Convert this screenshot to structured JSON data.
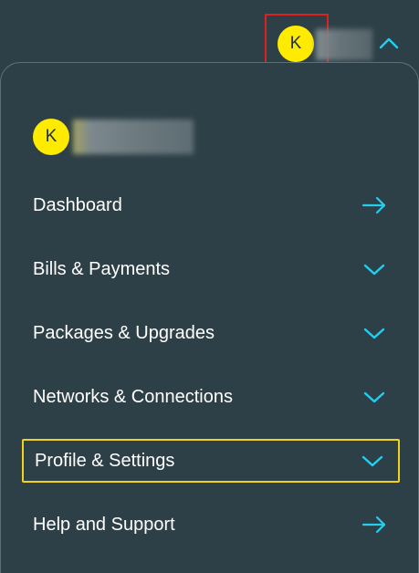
{
  "header": {
    "avatar_initial": "K"
  },
  "profile": {
    "avatar_initial": "K"
  },
  "menu": [
    {
      "label": "Dashboard",
      "icon": "arrow-right-icon"
    },
    {
      "label": "Bills & Payments",
      "icon": "chevron-down-icon"
    },
    {
      "label": "Packages & Upgrades",
      "icon": "chevron-down-icon"
    },
    {
      "label": "Networks & Connections",
      "icon": "chevron-down-icon"
    },
    {
      "label": "Profile & Settings",
      "icon": "chevron-down-icon"
    },
    {
      "label": "Help and Support",
      "icon": "arrow-right-icon"
    }
  ],
  "colors": {
    "background": "#2e4047",
    "accent": "#1fd0f0",
    "avatar": "#ffeb00",
    "highlight_border": "#f2d31b",
    "annotation_border": "#e02020"
  }
}
